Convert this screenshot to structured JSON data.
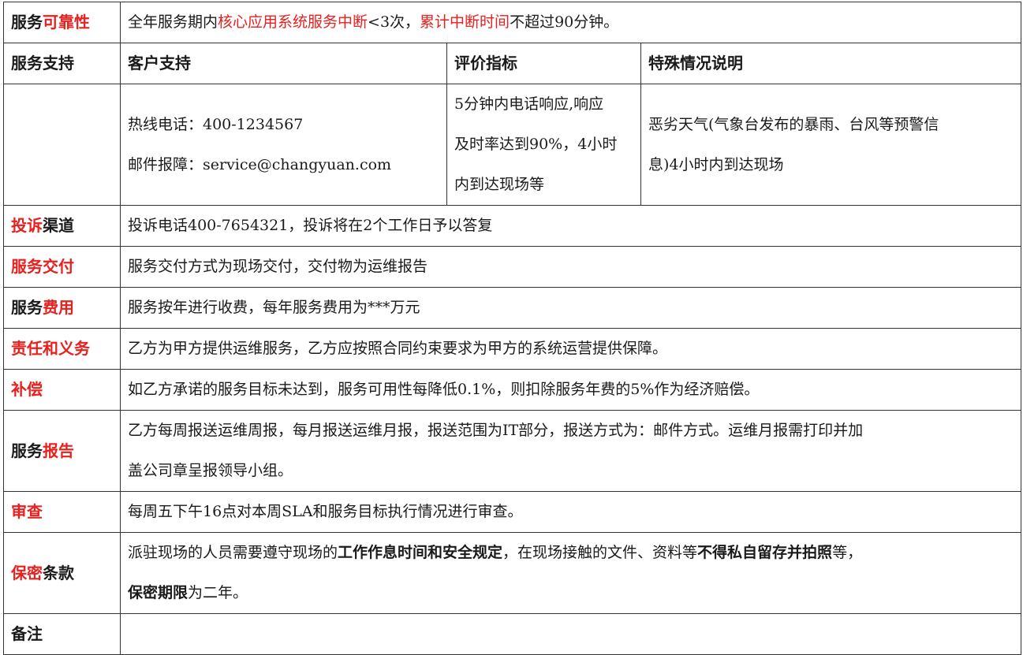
{
  "availability": {
    "label_a": "服务",
    "label_b": "可靠性",
    "text_a": "全年服务期内",
    "text_b": "核心应用系统服务中断",
    "text_c": "<3次，",
    "text_d": "累计中断时间",
    "text_e": "不超过90分钟。"
  },
  "support": {
    "label": "服务支持",
    "headers": [
      "客户支持",
      "评价指标",
      "特殊情况说明"
    ],
    "hotline": "热线电话：400-1234567",
    "email": "邮件报障：service@changyuan.com",
    "metric_lines": [
      "5分钟内电话响应,响应",
      "及时率达到90%，4小时",
      "内到达现场等"
    ],
    "special_lines": [
      "恶劣天气(气象台发布的暴雨、台风等预警信",
      "息)4小时内到达现场"
    ]
  },
  "rows": {
    "complaint": {
      "label_a": "投诉",
      "label_b": "渠道",
      "text": "投诉电话400-7654321，投诉将在2个工作日予以答复"
    },
    "delivery": {
      "label": "服务交付",
      "text": "服务交付方式为现场交付，交付物为运维报告"
    },
    "fees": {
      "label_a": "服务",
      "label_b": "费用",
      "text": "服务按年进行收费，每年服务费用为***万元"
    },
    "duty": {
      "label": "责任和义务",
      "text": "乙方为甲方提供运维服务，乙方应按照合同约束要求为甲方的系统运营提供保障。"
    },
    "compensation": {
      "label": "补偿",
      "text": "如乙方承诺的服务目标未达到，服务可用性每降低0.1%，则扣除服务年费的5%作为经济赔偿。"
    },
    "report": {
      "label_a": "服务",
      "label_b": "报告",
      "line1": "乙方每周报送运维周报，每月报送运维月报，报送范围为IT部分，报送方式为：邮件方式。运维月报需打印并加",
      "line2": "盖公司章呈报领导小组。"
    },
    "review": {
      "label": "审查",
      "text": "每周五下午16点对本周SLA和服务目标执行情况进行审查。"
    },
    "confidential": {
      "label_a": "保密",
      "label_b": "条款",
      "p1": "派驻现场的人员需要遵守现场的",
      "p2": "工作作息时间和安全规定",
      "p3": "，在现场接触的文件、资料等",
      "p4": "不得私自留存并拍照",
      "p5": "等，",
      "p6": "保密期限",
      "p7": "为二年。"
    },
    "notes": {
      "label": "备注"
    }
  }
}
